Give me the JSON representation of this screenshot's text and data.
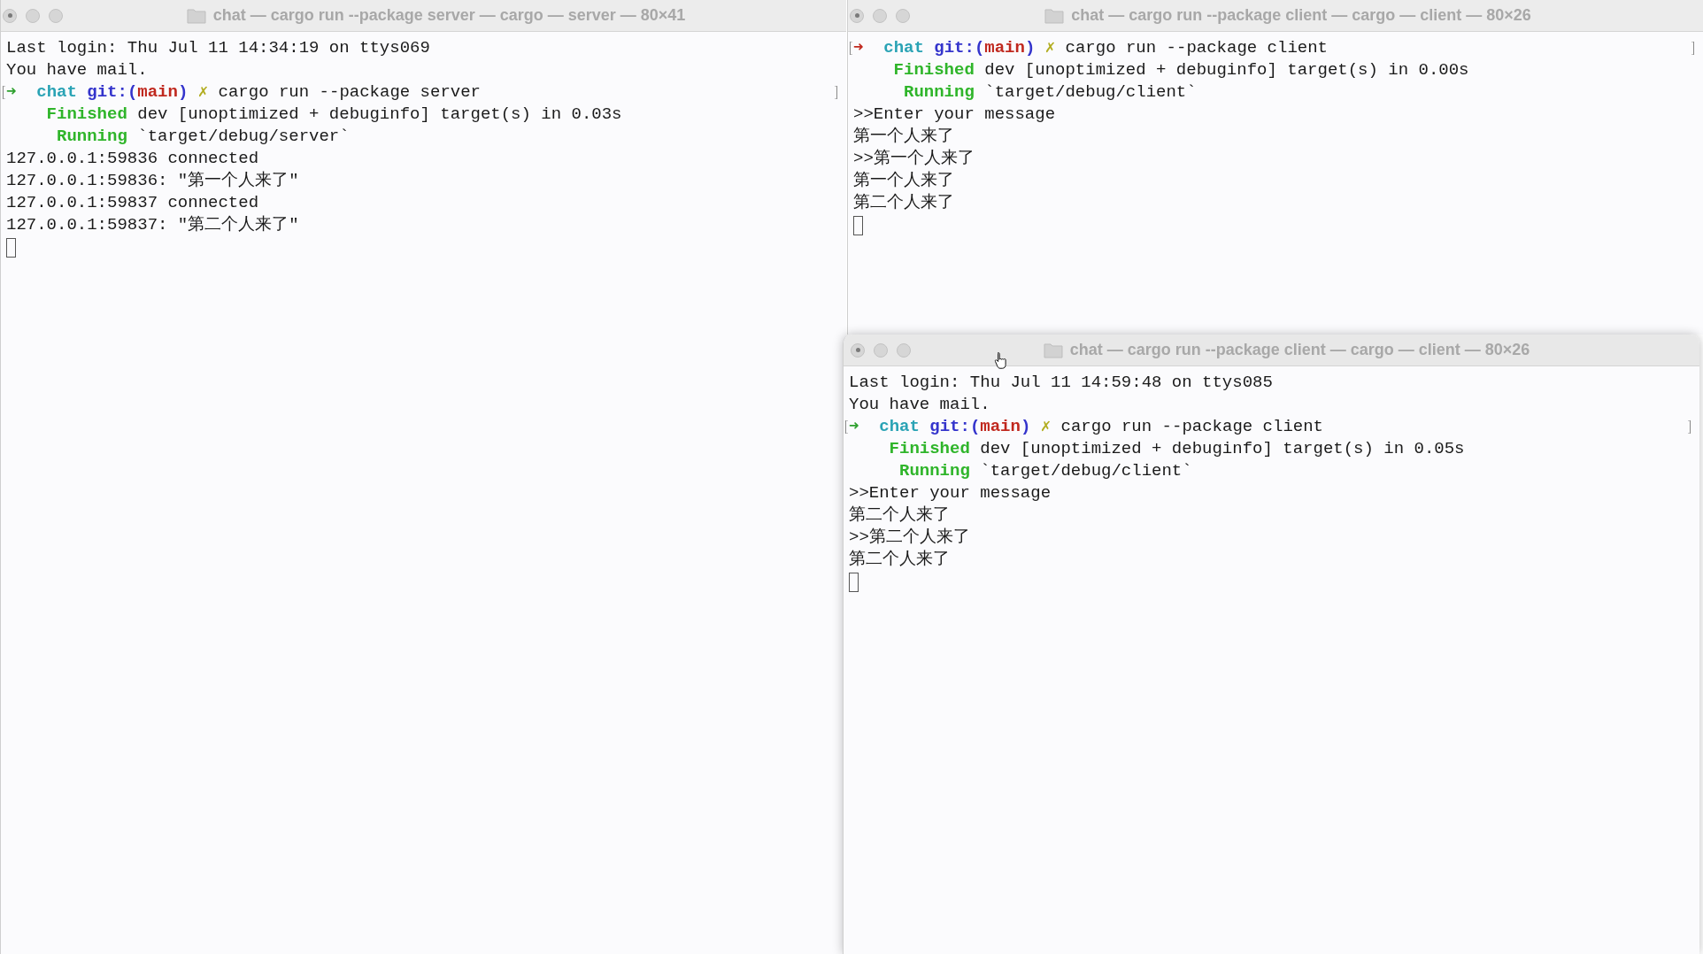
{
  "windows": [
    {
      "title": "chat — cargo run --package server — cargo — server — 80×41",
      "active": false,
      "cursor": true,
      "lines": [
        {
          "segments": [
            {
              "text": "Last login: Thu Jul 11 14:34:19 on ttys069",
              "color": "#1a1a1a",
              "bold": false
            }
          ]
        },
        {
          "segments": [
            {
              "text": "You have mail.",
              "color": "#1a1a1a",
              "bold": false
            }
          ]
        },
        {
          "marked": true,
          "segments": [
            {
              "text": "➜",
              "color": "#2ea02e"
            },
            {
              "text": "  chat",
              "color": "#2aa3b5",
              "bold": true
            },
            {
              "text": " git:(",
              "color": "#3434cc",
              "bold": true
            },
            {
              "text": "main",
              "color": "#c0281e",
              "bold": true
            },
            {
              "text": ")",
              "color": "#3434cc",
              "bold": true
            },
            {
              "text": " ✗",
              "color": "#b2ad20"
            },
            {
              "text": " cargo run --package server",
              "color": "#1a1a1a",
              "bold": false
            }
          ]
        },
        {
          "segments": [
            {
              "text": "    Finished",
              "color": "#2fb52a",
              "bold": true
            },
            {
              "text": " dev [unoptimized + debuginfo] target(s) in 0.03s",
              "color": "#1a1a1a",
              "bold": false
            }
          ]
        },
        {
          "segments": [
            {
              "text": "     Running",
              "color": "#2fb52a",
              "bold": true
            },
            {
              "text": " `target/debug/server`",
              "color": "#1a1a1a",
              "bold": false
            }
          ]
        },
        {
          "segments": [
            {
              "text": "127.0.0.1:59836 connected",
              "color": "#1a1a1a",
              "bold": false
            }
          ]
        },
        {
          "segments": [
            {
              "text": "127.0.0.1:59836: \"第一个人来了\"",
              "color": "#1a1a1a",
              "bold": false
            }
          ]
        },
        {
          "segments": [
            {
              "text": "127.0.0.1:59837 connected",
              "color": "#1a1a1a",
              "bold": false
            }
          ]
        },
        {
          "segments": [
            {
              "text": "127.0.0.1:59837: \"第二个人来了\"",
              "color": "#1a1a1a",
              "bold": false
            }
          ]
        }
      ]
    },
    {
      "title": "chat — cargo run --package client — cargo — client — 80×26",
      "active": false,
      "cursor": true,
      "lines": [
        {
          "marked": true,
          "segments": [
            {
              "text": "➜",
              "color": "#c0281e"
            },
            {
              "text": "  chat",
              "color": "#2aa3b5",
              "bold": true
            },
            {
              "text": " git:(",
              "color": "#3434cc",
              "bold": true
            },
            {
              "text": "main",
              "color": "#c0281e",
              "bold": true
            },
            {
              "text": ")",
              "color": "#3434cc",
              "bold": true
            },
            {
              "text": " ✗",
              "color": "#b2ad20"
            },
            {
              "text": " cargo run --package client",
              "color": "#1a1a1a",
              "bold": false
            }
          ]
        },
        {
          "segments": [
            {
              "text": "    Finished",
              "color": "#2fb52a",
              "bold": true
            },
            {
              "text": " dev [unoptimized + debuginfo] target(s) in 0.00s",
              "color": "#1a1a1a",
              "bold": false
            }
          ]
        },
        {
          "segments": [
            {
              "text": "     Running",
              "color": "#2fb52a",
              "bold": true
            },
            {
              "text": " `target/debug/client`",
              "color": "#1a1a1a",
              "bold": false
            }
          ]
        },
        {
          "segments": [
            {
              "text": ">>Enter your message",
              "color": "#1a1a1a",
              "bold": false
            }
          ]
        },
        {
          "segments": [
            {
              "text": "第一个人来了",
              "color": "#1a1a1a",
              "bold": false
            }
          ]
        },
        {
          "segments": [
            {
              "text": ">>第一个人来了",
              "color": "#1a1a1a",
              "bold": false
            }
          ]
        },
        {
          "segments": [
            {
              "text": "第一个人来了",
              "color": "#1a1a1a",
              "bold": false
            }
          ]
        },
        {
          "segments": [
            {
              "text": "第二个人来了",
              "color": "#1a1a1a",
              "bold": false
            }
          ]
        }
      ]
    },
    {
      "title": "chat — cargo run --package client — cargo — client — 80×26",
      "active": true,
      "cursor": true,
      "lines": [
        {
          "segments": [
            {
              "text": "Last login: Thu Jul 11 14:59:48 on ttys085",
              "color": "#1a1a1a",
              "bold": false
            }
          ]
        },
        {
          "segments": [
            {
              "text": "You have mail.",
              "color": "#1a1a1a",
              "bold": false
            }
          ]
        },
        {
          "marked": true,
          "segments": [
            {
              "text": "➜",
              "color": "#2ea02e"
            },
            {
              "text": "  chat",
              "color": "#2aa3b5",
              "bold": true
            },
            {
              "text": " git:(",
              "color": "#3434cc",
              "bold": true
            },
            {
              "text": "main",
              "color": "#c0281e",
              "bold": true
            },
            {
              "text": ")",
              "color": "#3434cc",
              "bold": true
            },
            {
              "text": " ✗",
              "color": "#b2ad20"
            },
            {
              "text": " cargo run --package client",
              "color": "#1a1a1a",
              "bold": false
            }
          ]
        },
        {
          "segments": [
            {
              "text": "    Finished",
              "color": "#2fb52a",
              "bold": true
            },
            {
              "text": " dev [unoptimized + debuginfo] target(s) in 0.05s",
              "color": "#1a1a1a",
              "bold": false
            }
          ]
        },
        {
          "segments": [
            {
              "text": "     Running",
              "color": "#2fb52a",
              "bold": true
            },
            {
              "text": " `target/debug/client`",
              "color": "#1a1a1a",
              "bold": false
            }
          ]
        },
        {
          "segments": [
            {
              "text": ">>Enter your message",
              "color": "#1a1a1a",
              "bold": false
            }
          ]
        },
        {
          "segments": [
            {
              "text": "第二个人来了",
              "color": "#1a1a1a",
              "bold": false
            }
          ]
        },
        {
          "segments": [
            {
              "text": ">>第二个人来了",
              "color": "#1a1a1a",
              "bold": false
            }
          ]
        },
        {
          "segments": [
            {
              "text": "第二个人来了",
              "color": "#1a1a1a",
              "bold": false
            }
          ]
        }
      ]
    }
  ]
}
